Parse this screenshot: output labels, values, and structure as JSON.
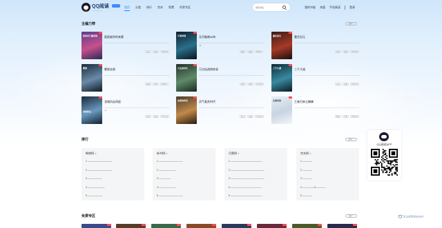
{
  "header": {
    "logo_text": "QQ阅读",
    "logo_sub": "—————",
    "nav": [
      "首页",
      "分类",
      "排行",
      "完本",
      "免费",
      "作家专区"
    ],
    "search_placeholder": "搜索书名",
    "user_links": [
      "我的书架",
      "充值",
      "手机阅读",
      "登录"
    ]
  },
  "featured": {
    "title": "主编力荐",
    "more": "更多 >",
    "books": [
      {
        "title": "星辰彼岸的来客",
        "cover_text": "我的宗门靠系统",
        "desc": "——————————————————————————————————————————————————",
        "meta": [
          "玄幻",
          "连载",
          "365万字"
        ],
        "colors": [
          "#5a3d8a",
          "#c6508c",
          "#2a2a55"
        ]
      },
      {
        "title": "无尽破晓48年",
        "cover_text": "午夜时刻",
        "desc": "—————————————————————————————————————————————48",
        "meta": [
          "都市",
          "连载",
          "88万字"
        ],
        "colors": [
          "#0e1f2e",
          "#2a6f8a",
          "#0a1520"
        ]
      },
      {
        "title": "重生纪元",
        "cover_text": "重生纪元",
        "desc": "——————————————————————————————————————————",
        "meta": [
          "历史",
          "连载",
          "276万字"
        ],
        "colors": [
          "#3a1a14",
          "#a63a28",
          "#1a0e0c"
        ]
      },
      {
        "title": "雾锁长夜",
        "cover_text": "雾锁",
        "desc": "——————————————————————————————————————————",
        "meta": [
          "悬疑",
          "完本",
          "92万字"
        ],
        "colors": [
          "#1a2a3a",
          "#6a8aa8",
          "#0e1a26"
        ]
      },
      {
        "title": "万古仙途修炼录",
        "cover_text": "人生的尽头",
        "desc": "——————————————\"—————————\"——————————————",
        "meta": [
          "仙侠",
          "连载",
          "131万字"
        ],
        "colors": [
          "#23332a",
          "#5f8a6a",
          "#1a2a20"
        ]
      },
      {
        "title": "三千大道",
        "cover_text": "三千大道",
        "desc": "———————————————————————————————————————————",
        "meta": [
          "玄幻",
          "连载",
          "128万字"
        ],
        "colors": [
          "#0e2a36",
          "#3a8aa0",
          "#0a1a22"
        ]
      },
      {
        "title": "龙城风云再起",
        "cover_text": "龙城风云",
        "desc": "——————————————————————————————————————————+2",
        "meta": [
          "武侠",
          "连载",
          "347万字"
        ],
        "colors": [
          "#1a2a3a",
          "#6a9abf",
          "#102030"
        ]
      },
      {
        "title": "灵气复苏时代",
        "cover_text": "这里的时光",
        "desc": "———————————————————————————————————————————",
        "meta": [
          "科幻",
          "连载",
          "210万字"
        ],
        "colors": [
          "#4a3a2a",
          "#c08a4a",
          "#2a1a10"
        ]
      },
      {
        "title": "王者归来之巅峰",
        "cover_text": "王者归来",
        "desc": "———————————————————————————————————————————",
        "meta": [
          "都市",
          "完本",
          "188万字"
        ],
        "colors": [
          "#e8eef4",
          "#c8d4e2",
          "#f4f6f8"
        ]
      }
    ]
  },
  "ranking": {
    "title": "排行",
    "more": "更多 >",
    "panels": [
      {
        "title": "畅销榜 >",
        "items": [
          "1 ——————————",
          "2 ——————————",
          "3 ——————",
          "4 ———————",
          "5 ——————"
        ]
      },
      {
        "title": "新书榜 >",
        "items": [
          "1 ——————————",
          "2 ———————",
          "3 —————",
          "4 ———————",
          "5 ——————————"
        ]
      },
      {
        "title": "月票榜 >",
        "items": [
          "1 —————————————",
          "2 ——————————————",
          "3 ——————————————",
          "4 —————————————",
          "5 —————————————"
        ]
      },
      {
        "title": "完本榜 >",
        "items": [
          "1 ————",
          "2 ————",
          "3 ————",
          "4 —————II————",
          "5 ————"
        ]
      }
    ]
  },
  "qr": {
    "label": "QQ阅读APP"
  },
  "bottom": {
    "title": "免费专区",
    "more": "更多 >"
  },
  "watermark": "ScanMalware"
}
